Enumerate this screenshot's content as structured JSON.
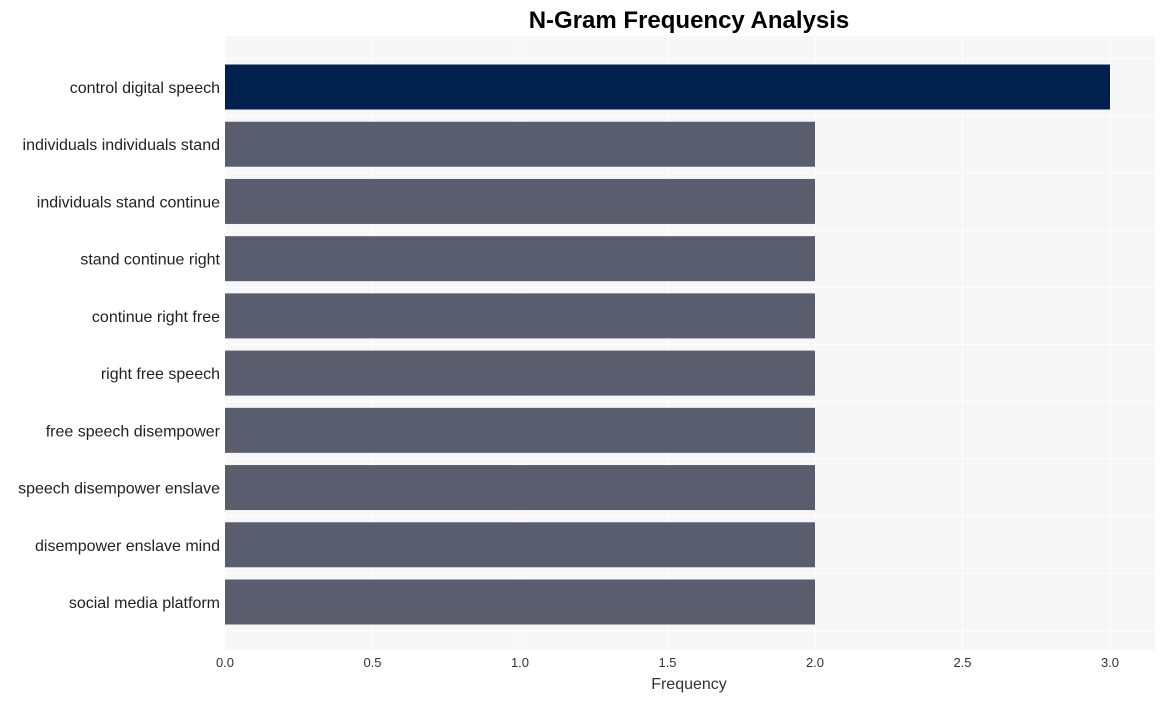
{
  "chart_data": {
    "type": "bar",
    "orientation": "horizontal",
    "title": "N-Gram Frequency Analysis",
    "xlabel": "Frequency",
    "ylabel": "",
    "xlim": [
      0,
      3.15
    ],
    "xticks": [
      "0.0",
      "0.5",
      "1.0",
      "1.5",
      "2.0",
      "2.5",
      "3.0"
    ],
    "xtick_values": [
      0,
      0.5,
      1.0,
      1.5,
      2.0,
      2.5,
      3.0
    ],
    "grid": true,
    "categories": [
      "control digital speech",
      "individuals individuals stand",
      "individuals stand continue",
      "stand continue right",
      "continue right free",
      "right free speech",
      "free speech disempower",
      "speech disempower enslave",
      "disempower enslave mind",
      "social media platform"
    ],
    "values": [
      3,
      2,
      2,
      2,
      2,
      2,
      2,
      2,
      2,
      2
    ],
    "colors": {
      "highlight": "#00214d",
      "default": "#595d6d",
      "plot_background": "#f7f7f7",
      "grid": "#ffffff"
    }
  }
}
